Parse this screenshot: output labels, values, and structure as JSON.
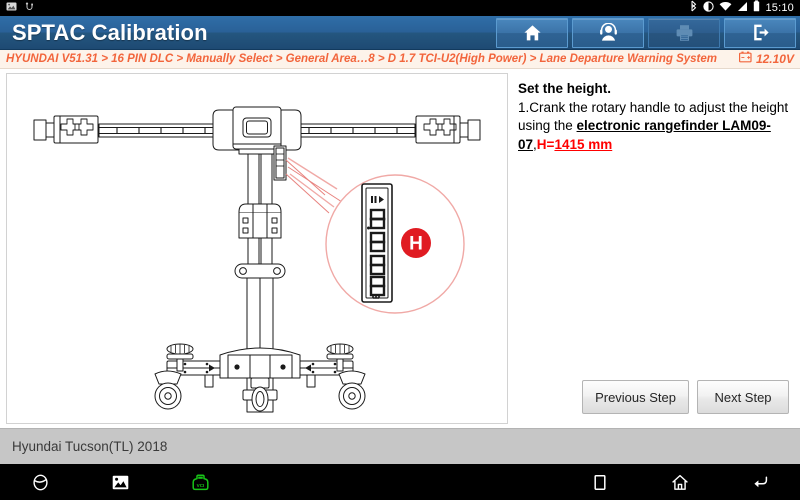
{
  "status_bar": {
    "time": "15:10",
    "left_icons": [
      "screenshot-icon",
      "usb-icon"
    ],
    "right_icons": [
      "bluetooth-icon",
      "rotation-lock-icon",
      "wifi-icon",
      "signal-icon",
      "battery-icon"
    ]
  },
  "titlebar": {
    "title": "SPTAC Calibration",
    "buttons": [
      {
        "name": "home-button",
        "icon": "home-icon",
        "disabled": false
      },
      {
        "name": "support-button",
        "icon": "headset-icon",
        "disabled": false
      },
      {
        "name": "print-button",
        "icon": "printer-icon",
        "disabled": true
      },
      {
        "name": "exit-button",
        "icon": "exit-icon",
        "disabled": false
      }
    ]
  },
  "breadcrumb": {
    "path": "HYUNDAI V51.31 > 16 PIN DLC > Manually Select > General Area…8 > D 1.7 TCI-U2(High Power) > Lane Departure Warning System",
    "battery_icon": "battery-voltage-icon",
    "voltage": "12.10V",
    "color": "#f2653c"
  },
  "instructions": {
    "heading": "Set the height.",
    "step_number": "1.",
    "text_before": "Crank the rotary handle to adjust the height using the ",
    "emphasis": "electronic rangefinder LAM09-07",
    "separator": ",",
    "label": "H=",
    "value": "1415 mm",
    "value_color": "#ff0000"
  },
  "buttons": {
    "previous": "Previous Step",
    "next": "Next Step"
  },
  "diagram": {
    "name": "calibration-frame-diagram",
    "callout_label": "H",
    "callout_color": "#e01b22",
    "rangefinder_name": "electronic-rangefinder-display"
  },
  "vehicle_bar": {
    "vehicle": "Hyundai Tucson(TL) 2018"
  },
  "nav_bar": {
    "left_items": [
      {
        "name": "browser-button",
        "icon": "browser-icon"
      },
      {
        "name": "gallery-button",
        "icon": "gallery-icon"
      },
      {
        "name": "vci-button",
        "icon": "vci-icon",
        "color": "#18c418"
      }
    ],
    "right_items": [
      {
        "name": "recents-button",
        "icon": "recents-icon"
      },
      {
        "name": "home-button",
        "icon": "home-icon"
      },
      {
        "name": "back-button",
        "icon": "back-icon"
      }
    ]
  }
}
